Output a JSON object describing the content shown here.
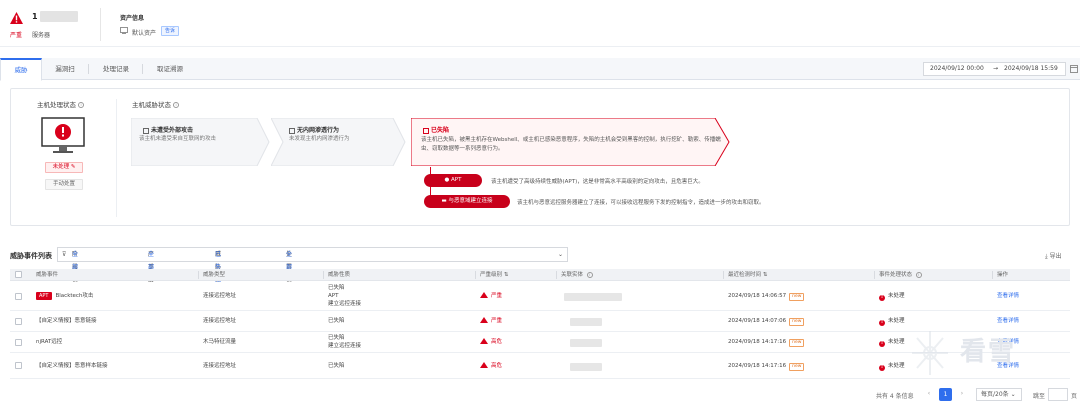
{
  "header": {
    "severity": "严重",
    "host_ip": "1",
    "host_type": "服务器",
    "asset_title": "资产信息",
    "asset_value": "默认资产",
    "asset_tag": "告诉"
  },
  "tabs": [
    "威胁",
    "漏洞扫",
    "处理记录",
    "取证溯源"
  ],
  "date_range": {
    "start": "2024/09/12 00:00",
    "sep": "→",
    "end": "2024/09/18 15:59"
  },
  "status_panel": {
    "host_status_title": "主机处理状态",
    "host_status_value": "未处理",
    "mark_button": "手动处置",
    "threat_status_title": "主机威胁状态",
    "stages": [
      {
        "title": "未遭受外部攻击",
        "desc": "该主机未遭受来自互联网的攻击"
      },
      {
        "title": "无内网渗透行为",
        "desc": "未发现主机内网渗透行为"
      }
    ],
    "lost": {
      "title": "已失陷",
      "desc": "该主机已失陷，被黑主机存在Webshell、或主机已感染恶意程序，失陷的主机会受到黑客的控制，执行挖矿、勒索、传播蠕虫、窃取数据等一系列恶意行为。"
    },
    "tags": [
      {
        "label": "APT",
        "desc": "该主机遭受了高级持续性威胁(APT)，这是非常高水平高级别的定向攻击，且危害巨大。"
      },
      {
        "label": "与恶意域建立连接",
        "desc": "该主机与恶意远控服务器建立了连接，可以接收远程服务下发的控制指令，造成进一步的攻击和窃取。"
      }
    ]
  },
  "events": {
    "title": "威胁事件列表",
    "filters": [
      {
        "label": "阶段状态:",
        "value": "全部"
      },
      {
        "label": "严重级别:",
        "value": "全部"
      },
      {
        "label": "威胁性质:",
        "value": "已失陷"
      },
      {
        "label": "处置状态:",
        "value": "全部"
      }
    ],
    "export_label": "导出",
    "columns": [
      "威胁事件",
      "威胁类型",
      "威胁性质",
      "严重级别",
      "关联实体",
      "最近检测时间",
      "事件处理状态",
      "操作"
    ],
    "rows": [
      {
        "apt": "APT",
        "name": "Blacktech攻击",
        "type": "连接远控地址",
        "nature": [
          "已失陷",
          "APT",
          "建立远控连接"
        ],
        "severity": "严重",
        "time": "2024/09/18 14:06:57",
        "new": "new",
        "status": "未处理",
        "action": "查看详情"
      },
      {
        "apt": "",
        "name": "【自定义情报】恶意链接",
        "type": "连接远控地址",
        "nature": [
          "已失陷"
        ],
        "severity": "严重",
        "time": "2024/09/18 14:07:06",
        "new": "new",
        "status": "未处理",
        "action": "查看详情"
      },
      {
        "apt": "",
        "name": "njRAT远控",
        "type": "木马特征流量",
        "nature": [
          "已失陷",
          "建立远控连接"
        ],
        "severity": "高危",
        "time": "2024/09/18 14:17:16",
        "new": "new",
        "status": "未处理",
        "action": "查看详情"
      },
      {
        "apt": "",
        "name": "【自定义情报】恶意样本链接",
        "type": "连接远控地址",
        "nature": [
          "已失陷"
        ],
        "severity": "高危",
        "time": "2024/09/18 14:17:16",
        "new": "new",
        "status": "未处理",
        "action": "查看详情"
      }
    ]
  },
  "pagination": {
    "total": "共有 4 条信息",
    "prev": "‹",
    "current": "1",
    "next": "›",
    "page_size": "每页/20条",
    "jump_label": "跳至",
    "page_label": "页"
  },
  "watermark": "看雪",
  "colors": {
    "danger": "#d9001b",
    "accent": "#2f6eed"
  }
}
